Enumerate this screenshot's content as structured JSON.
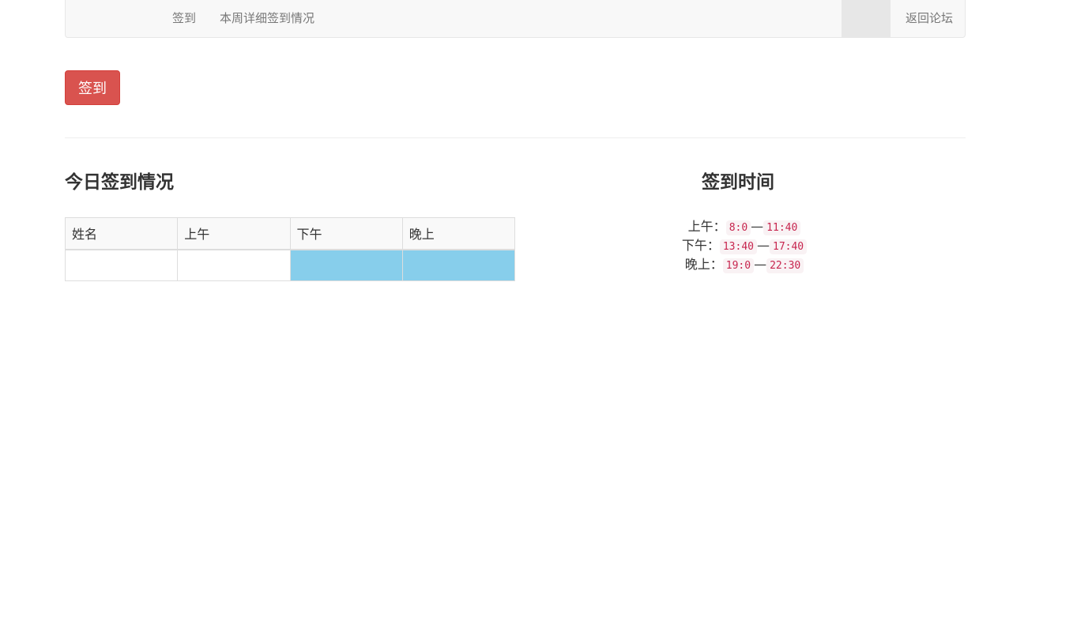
{
  "navbar": {
    "links": [
      "签到",
      "本周详细签到情况"
    ],
    "right_link": "返回论坛"
  },
  "sign_button": "签到",
  "today": {
    "title": "今日签到情况",
    "columns": [
      "姓名",
      "上午",
      "下午",
      "晚上"
    ],
    "rows": [
      {
        "cells": [
          "",
          "",
          "",
          ""
        ],
        "filled": [
          false,
          false,
          true,
          true
        ]
      }
    ]
  },
  "schedule": {
    "title": "签到时间",
    "separator": "—",
    "items": [
      {
        "label": "上午：",
        "start": "8:0",
        "end": "11:40"
      },
      {
        "label": "下午：",
        "start": "13:40",
        "end": "17:40"
      },
      {
        "label": "晚上：",
        "start": "19:0",
        "end": "22:30"
      }
    ]
  },
  "colors": {
    "danger": "#d9534f",
    "filled_cell": "#87ceeb",
    "code_text": "#c7254e",
    "code_bg": "#f9f2f4"
  }
}
